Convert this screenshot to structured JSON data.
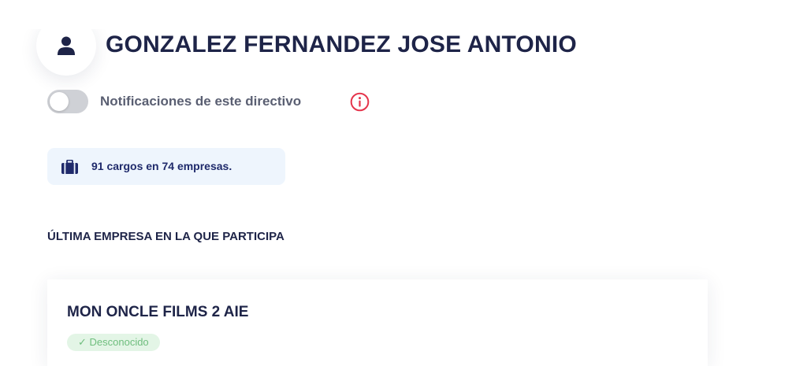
{
  "profile": {
    "name": "GONZALEZ FERNANDEZ JOSE ANTONIO",
    "avatar_icon": "user-icon"
  },
  "notifications": {
    "label": "Notificaciones de este directivo",
    "enabled": false,
    "info_icon": "info-icon"
  },
  "summary": {
    "icon": "briefcase-icon",
    "text": "91 cargos en 74 empresas."
  },
  "section": {
    "heading": "ÚLTIMA EMPRESA EN LA QUE PARTICIPA"
  },
  "company": {
    "name": "MON ONCLE FILMS 2 AIE",
    "status": "✓ Desconocido"
  },
  "colors": {
    "title": "#1e2448",
    "accent_blue": "#1f2a6b",
    "info_red": "#e5344b",
    "badge_green": "#6fbe7e",
    "badge_bg": "#e3f5e6",
    "summary_bg": "#eef5fd",
    "toggle_off": "#cfd1d6"
  }
}
